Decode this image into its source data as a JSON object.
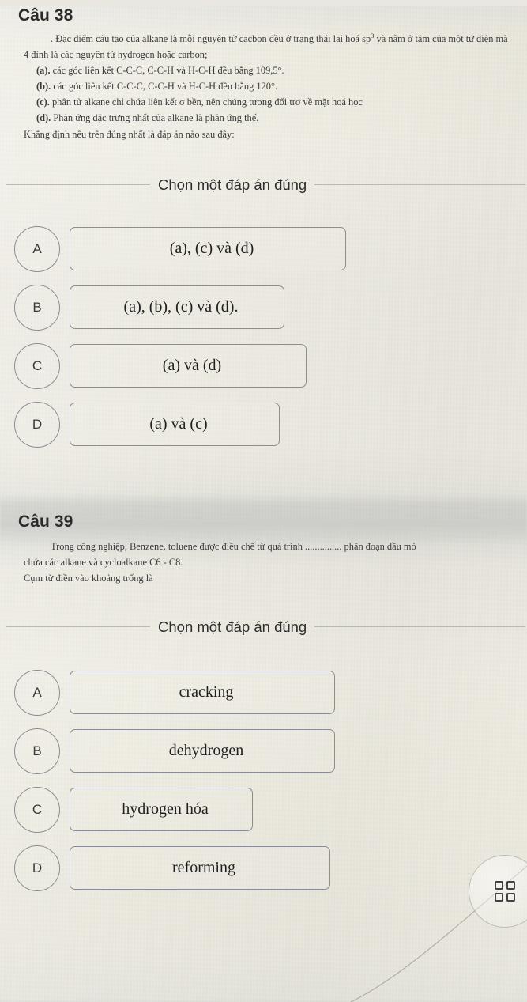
{
  "theme": {
    "page_bg": "#e9e7df",
    "text": "#2a2a2a",
    "outline": "#8a8d95"
  },
  "questions": [
    {
      "number_label": "Câu 38",
      "stem_lines": [
        ". Đặc điểm cấu tạo của alkane là mỗi nguyên tử cacbon đều ở trạng thái lai hoá sp³ và nằm ở tâm của một tứ diện  mà 4 đỉnh là các nguyên tử hydrogen hoặc carbon;",
        "(a). các góc liên kết C-C-C, C-C-H và H-C-H đều bằng 109,5°.",
        "(b). các góc liên kết C-C-C, C-C-H và H-C-H đều bằng 120°.",
        "(c). phân tử alkane chỉ chứa liên kết σ bền, nên chúng tương đối trơ về mặt hoá học",
        "(d). Phản ứng đặc trưng nhất của alkane là phản ứng thế.",
        "Khẳng định nêu trên đúng nhất là đáp án nào sau đây:"
      ],
      "stem_parts": {
        "lead": ". Đặc điểm cấu tạo của alkane là mỗi nguyên tử cacbon đều ở trạng thái lai hoá sp",
        "lead_sup": "3",
        "lead_tail": " và nằm ở tâm của một tứ diện  mà 4 đỉnh là các nguyên tử hydrogen hoặc carbon;",
        "a_marker": "(a).",
        "a_text": " các góc liên kết C-C-C, C-C-H và H-C-H đều bằng 109,5°.",
        "b_marker": "(b).",
        "b_text": " các góc liên kết C-C-C, C-C-H và H-C-H đều bằng 120°.",
        "c_marker": "(c).",
        "c_text": " phân tử alkane chỉ chứa liên kết σ bền, nên chúng tương đối trơ về mặt hoá học",
        "d_marker": "(d).",
        "d_text": " Phản ứng đặc trưng nhất của alkane là phản ứng thế.",
        "closing": "Khẳng định nêu trên đúng nhất là đáp án nào sau đây:"
      },
      "choose_label": "Chọn một đáp án đúng",
      "options": [
        {
          "letter": "A",
          "text": "(a), (c)  và (d)"
        },
        {
          "letter": "B",
          "text": "(a), (b), (c) và (d)."
        },
        {
          "letter": "C",
          "text": "(a) và (d)"
        },
        {
          "letter": "D",
          "text": "(a) và (c)"
        }
      ]
    },
    {
      "number_label": "Câu 39",
      "stem_parts": {
        "line1": "Trong công nghiệp, Benzene, toluene được điều chế từ quá trình ............... phân đoạn dầu mỏ",
        "line2": "chứa các alkane và cycloalkane C6 - C8.",
        "line3": "Cụm từ điền vào khoảng trống là"
      },
      "choose_label": "Chọn một đáp án đúng",
      "options": [
        {
          "letter": "A",
          "text": "cracking"
        },
        {
          "letter": "B",
          "text": "dehydrogen"
        },
        {
          "letter": "C",
          "text": "hydrogen hóa"
        },
        {
          "letter": "D",
          "text": "reforming"
        }
      ]
    }
  ],
  "fab": {
    "icon": "grid-icon",
    "label": ""
  }
}
